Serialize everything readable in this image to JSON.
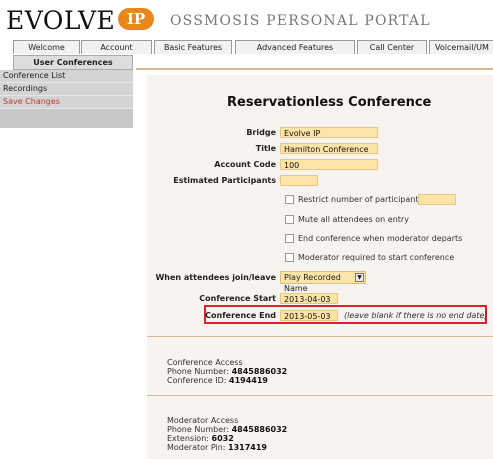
{
  "header": {
    "logo": "EVOLVE",
    "logo_badge": "IP",
    "portal_title": "OSSMOSIS PERSONAL PORTAL"
  },
  "tabs": [
    {
      "label": "Welcome"
    },
    {
      "label": "Account"
    },
    {
      "label": "Basic Features"
    },
    {
      "label": "Advanced Features"
    },
    {
      "label": "Call Center"
    },
    {
      "label": "Voicemail/UM"
    }
  ],
  "subtab": "User Conferences",
  "sidebar": {
    "items": [
      {
        "label": "Conference List"
      },
      {
        "label": "Recordings"
      },
      {
        "label": "Save Changes"
      }
    ]
  },
  "form": {
    "title": "Reservationless Conference",
    "bridge_label": "Bridge",
    "bridge_value": "Evolve IP",
    "title_label": "Title",
    "title_value": "Hamilton Conference",
    "account_code_label": "Account Code",
    "account_code_value": "100",
    "estimated_label": "Estimated Participants",
    "estimated_value": "",
    "restrict_label": "Restrict number of participants",
    "restrict_value": "",
    "mute_label": "Mute all attendees on entry",
    "end_label": "End conference when moderator departs",
    "moderator_label": "Moderator required to start conference",
    "join_leave_label": "When attendees join/leave",
    "join_leave_value": "Play Recorded Name",
    "start_label": "Conference Start",
    "start_value": "2013-04-03",
    "end_date_label": "Conference End",
    "end_date_value": "2013-05-03",
    "end_hint": "(leave blank if there is no end date)"
  },
  "conference_access": {
    "heading": "Conference Access",
    "phone_label": "Phone Number: ",
    "phone": "4845886032",
    "id_label": "Conference ID: ",
    "id": "4194419"
  },
  "moderator_access": {
    "heading": "Moderator Access",
    "phone_label": "Phone Number: ",
    "phone": "4845886032",
    "ext_label": "Extension: ",
    "ext": "6032",
    "pin_label": "Moderator Pin: ",
    "pin": "1317419"
  }
}
